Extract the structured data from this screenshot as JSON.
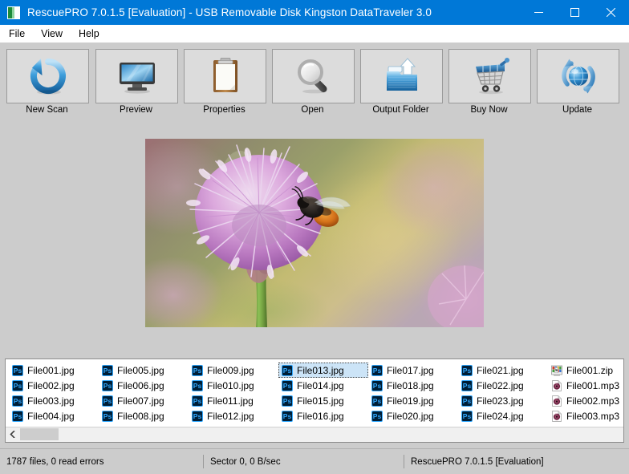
{
  "window": {
    "title": "RescuePRO 7.0.1.5 [Evaluation] - USB Removable Disk Kingston DataTraveler 3.0",
    "app_icon": "rescuepro-logo-icon",
    "controls": {
      "minimize": "minimize-icon",
      "maximize": "maximize-icon",
      "close": "close-icon"
    },
    "accent_color": "#0078d7",
    "chrome_color": "#cccccc"
  },
  "menubar": {
    "items": [
      {
        "label": "File"
      },
      {
        "label": "View"
      },
      {
        "label": "Help"
      }
    ]
  },
  "toolbar": {
    "buttons": [
      {
        "label": "New Scan",
        "icon": "refresh-arrow-icon"
      },
      {
        "label": "Preview",
        "icon": "monitor-icon"
      },
      {
        "label": "Properties",
        "icon": "clipboard-icon"
      },
      {
        "label": "Open",
        "icon": "magnifier-icon"
      },
      {
        "label": "Output Folder",
        "icon": "folder-upload-icon"
      },
      {
        "label": "Buy Now",
        "icon": "shopping-cart-icon"
      },
      {
        "label": "Update",
        "icon": "globe-refresh-icon"
      }
    ]
  },
  "preview": {
    "description": "chive flower with bumblebee photograph"
  },
  "filelist": {
    "selected": "File013.jpg",
    "items": [
      {
        "name": "File001.jpg",
        "icon": "photoshop-icon"
      },
      {
        "name": "File002.jpg",
        "icon": "photoshop-icon"
      },
      {
        "name": "File003.jpg",
        "icon": "photoshop-icon"
      },
      {
        "name": "File004.jpg",
        "icon": "photoshop-icon"
      },
      {
        "name": "File005.jpg",
        "icon": "photoshop-icon"
      },
      {
        "name": "File006.jpg",
        "icon": "photoshop-icon"
      },
      {
        "name": "File007.jpg",
        "icon": "photoshop-icon"
      },
      {
        "name": "File008.jpg",
        "icon": "photoshop-icon"
      },
      {
        "name": "File009.jpg",
        "icon": "photoshop-icon"
      },
      {
        "name": "File010.jpg",
        "icon": "photoshop-icon"
      },
      {
        "name": "File011.jpg",
        "icon": "photoshop-icon"
      },
      {
        "name": "File012.jpg",
        "icon": "photoshop-icon"
      },
      {
        "name": "File013.jpg",
        "icon": "photoshop-icon"
      },
      {
        "name": "File014.jpg",
        "icon": "photoshop-icon"
      },
      {
        "name": "File015.jpg",
        "icon": "photoshop-icon"
      },
      {
        "name": "File016.jpg",
        "icon": "photoshop-icon"
      },
      {
        "name": "File017.jpg",
        "icon": "photoshop-icon"
      },
      {
        "name": "File018.jpg",
        "icon": "photoshop-icon"
      },
      {
        "name": "File019.jpg",
        "icon": "photoshop-icon"
      },
      {
        "name": "File020.jpg",
        "icon": "photoshop-icon"
      },
      {
        "name": "File021.jpg",
        "icon": "photoshop-icon"
      },
      {
        "name": "File022.jpg",
        "icon": "photoshop-icon"
      },
      {
        "name": "File023.jpg",
        "icon": "photoshop-icon"
      },
      {
        "name": "File024.jpg",
        "icon": "photoshop-icon"
      },
      {
        "name": "File001.zip",
        "icon": "archive-icon"
      },
      {
        "name": "File001.mp3",
        "icon": "audio-disc-icon"
      },
      {
        "name": "File002.mp3",
        "icon": "audio-disc-icon"
      },
      {
        "name": "File003.mp3",
        "icon": "audio-disc-icon"
      }
    ],
    "scrollbar": {
      "left_arrow": "chevron-left-icon"
    }
  },
  "statusbar": {
    "panes": [
      {
        "text": "1787 files, 0 read errors"
      },
      {
        "text": "Sector 0, 0 B/sec"
      },
      {
        "text": "RescuePRO 7.0.1.5 [Evaluation]"
      }
    ]
  }
}
